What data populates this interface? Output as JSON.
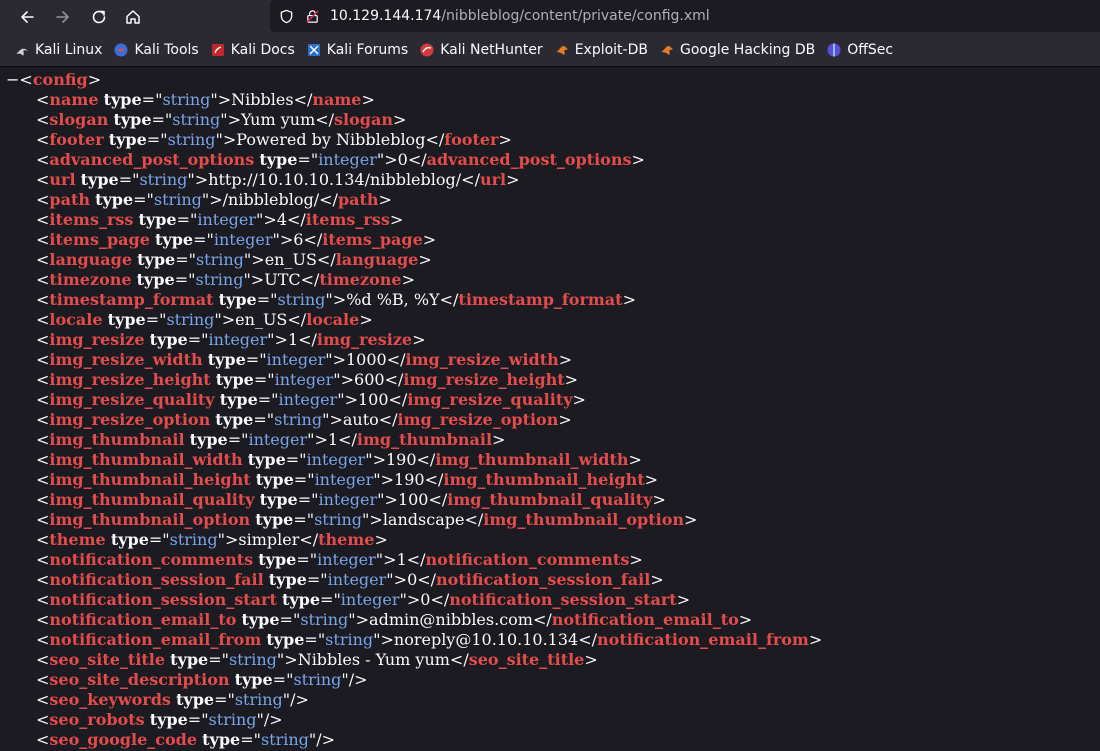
{
  "browser": {
    "url_host": "10.129.144.174",
    "url_path": "/nibbleblog/content/private/config.xml",
    "icons": {
      "back": "back-arrow-icon",
      "forward": "forward-arrow-icon",
      "reload": "reload-icon",
      "home": "home-icon",
      "shield": "shield-icon",
      "insecure": "insecure-lock-icon"
    }
  },
  "bookmarks": [
    {
      "label": "Kali Linux",
      "icon": "kali-dragon-icon"
    },
    {
      "label": "Kali Tools",
      "icon": "kali-tools-icon"
    },
    {
      "label": "Kali Docs",
      "icon": "kali-docs-icon"
    },
    {
      "label": "Kali Forums",
      "icon": "kali-forums-icon"
    },
    {
      "label": "Kali NetHunter",
      "icon": "kali-nethunter-icon"
    },
    {
      "label": "Exploit-DB",
      "icon": "exploit-db-icon"
    },
    {
      "label": "Google Hacking DB",
      "icon": "ghdb-icon"
    },
    {
      "label": "OffSec",
      "icon": "offsec-icon"
    }
  ],
  "xml": {
    "collapse_toggle": "−",
    "root_tag": "config",
    "type_attr": "type",
    "elements": [
      {
        "name": "name",
        "type": "string",
        "value": "Nibbles"
      },
      {
        "name": "slogan",
        "type": "string",
        "value": "Yum yum"
      },
      {
        "name": "footer",
        "type": "string",
        "value": "Powered by Nibbleblog"
      },
      {
        "name": "advanced_post_options",
        "type": "integer",
        "value": "0"
      },
      {
        "name": "url",
        "type": "string",
        "value": "http://10.10.10.134/nibbleblog/"
      },
      {
        "name": "path",
        "type": "string",
        "value": "/nibbleblog/"
      },
      {
        "name": "items_rss",
        "type": "integer",
        "value": "4"
      },
      {
        "name": "items_page",
        "type": "integer",
        "value": "6"
      },
      {
        "name": "language",
        "type": "string",
        "value": "en_US"
      },
      {
        "name": "timezone",
        "type": "string",
        "value": "UTC"
      },
      {
        "name": "timestamp_format",
        "type": "string",
        "value": "%d %B, %Y"
      },
      {
        "name": "locale",
        "type": "string",
        "value": "en_US"
      },
      {
        "name": "img_resize",
        "type": "integer",
        "value": "1"
      },
      {
        "name": "img_resize_width",
        "type": "integer",
        "value": "1000"
      },
      {
        "name": "img_resize_height",
        "type": "integer",
        "value": "600"
      },
      {
        "name": "img_resize_quality",
        "type": "integer",
        "value": "100"
      },
      {
        "name": "img_resize_option",
        "type": "string",
        "value": "auto"
      },
      {
        "name": "img_thumbnail",
        "type": "integer",
        "value": "1"
      },
      {
        "name": "img_thumbnail_width",
        "type": "integer",
        "value": "190"
      },
      {
        "name": "img_thumbnail_height",
        "type": "integer",
        "value": "190"
      },
      {
        "name": "img_thumbnail_quality",
        "type": "integer",
        "value": "100"
      },
      {
        "name": "img_thumbnail_option",
        "type": "string",
        "value": "landscape"
      },
      {
        "name": "theme",
        "type": "string",
        "value": "simpler"
      },
      {
        "name": "notification_comments",
        "type": "integer",
        "value": "1"
      },
      {
        "name": "notification_session_fail",
        "type": "integer",
        "value": "0"
      },
      {
        "name": "notification_session_start",
        "type": "integer",
        "value": "0"
      },
      {
        "name": "notification_email_to",
        "type": "string",
        "value": "admin@nibbles.com"
      },
      {
        "name": "notification_email_from",
        "type": "string",
        "value": "noreply@10.10.10.134"
      },
      {
        "name": "seo_site_title",
        "type": "string",
        "value": "Nibbles - Yum yum"
      },
      {
        "name": "seo_site_description",
        "type": "string",
        "value": null
      },
      {
        "name": "seo_keywords",
        "type": "string",
        "value": null
      },
      {
        "name": "seo_robots",
        "type": "string",
        "value": null
      },
      {
        "name": "seo_google_code",
        "type": "string",
        "value": null
      }
    ]
  }
}
